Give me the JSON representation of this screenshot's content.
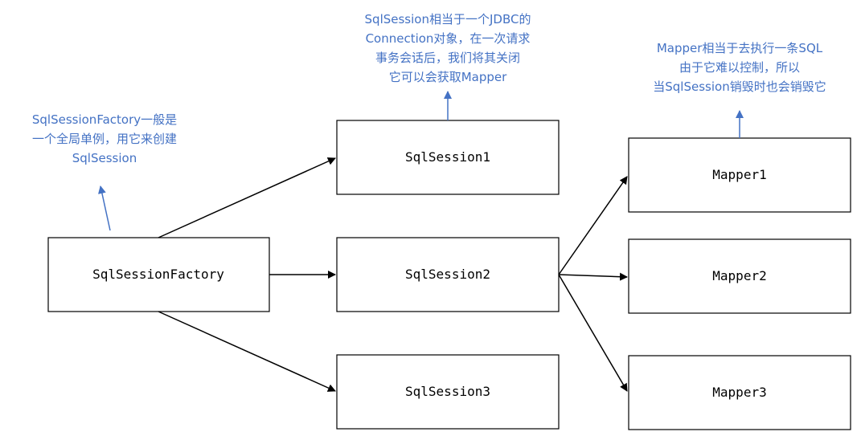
{
  "boxes": {
    "factory": "SqlSessionFactory",
    "session1": "SqlSession1",
    "session2": "SqlSession2",
    "session3": "SqlSession3",
    "mapper1": "Mapper1",
    "mapper2": "Mapper2",
    "mapper3": "Mapper3"
  },
  "notes": {
    "factory": [
      "SqlSessionFactory一般是",
      "一个全局单例，用它来创建",
      "SqlSession"
    ],
    "session": [
      "SqlSession相当于一个JDBC的",
      "Connection对象，在一次请求",
      "事务会话后，我们将其关闭",
      "它可以会获取Mapper"
    ],
    "mapper": [
      "Mapper相当于去执行一条SQL",
      "由于它难以控制，所以",
      "当SqlSession销毁时也会销毁它"
    ]
  },
  "colors": {
    "note": "#4472c4",
    "line": "#000000",
    "box_border": "#000000"
  }
}
